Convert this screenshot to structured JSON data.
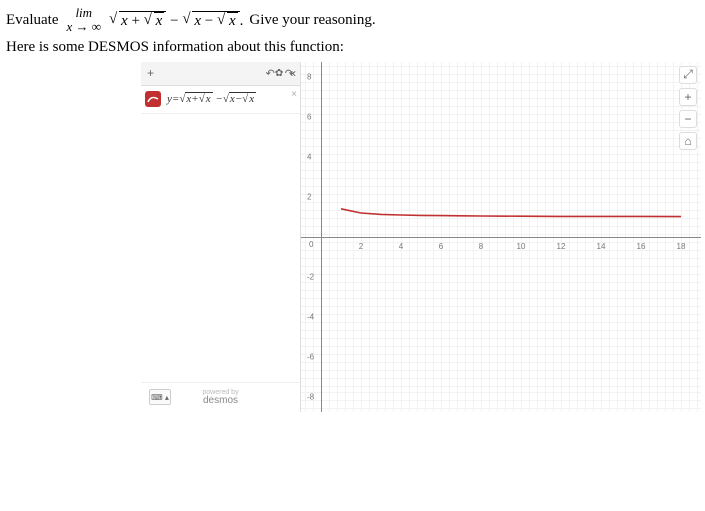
{
  "problem": {
    "prefix": "Evaluate",
    "limit_top": "lim",
    "limit_bottom": "x → ∞",
    "expr_outer1_inner_var": "x",
    "expr_plus": " + ",
    "expr_minus_big": " − ",
    "expr_outer2_inner_var": "x",
    "expr_minus_small": " − ",
    "period": ".",
    "suffix": "  Give your reasoning."
  },
  "desmos_info": "Here is some DESMOS information about this function:",
  "sidebar": {
    "plus": "+",
    "undo": "↶",
    "redo": "↷",
    "gear": "✿",
    "collapse": "«",
    "expr_label_y": "y",
    "expr_label_eq": "=",
    "expr_label_a": "x+",
    "expr_label_b": "x",
    "expr_label_c": "x−",
    "expr_label_d": "x",
    "expr_minus": " −",
    "close": "×",
    "keyboard": "⌨ ▴",
    "powered_by": "powered by",
    "brand": "desmos"
  },
  "controls": {
    "zoom_tool": "⤢",
    "zoom_in": "+",
    "zoom_out": "−",
    "home": "⌂"
  },
  "axes": {
    "x_ticks": [
      {
        "v": "2",
        "px": 60
      },
      {
        "v": "4",
        "px": 100
      },
      {
        "v": "6",
        "px": 140
      },
      {
        "v": "8",
        "px": 180
      },
      {
        "v": "10",
        "px": 220
      },
      {
        "v": "12",
        "px": 260
      },
      {
        "v": "14",
        "px": 300
      },
      {
        "v": "16",
        "px": 340
      },
      {
        "v": "18",
        "px": 380
      }
    ],
    "y_ticks": [
      {
        "v": "8",
        "px": 15
      },
      {
        "v": "6",
        "px": 55
      },
      {
        "v": "4",
        "px": 95
      },
      {
        "v": "2",
        "px": 135
      },
      {
        "v": "-2",
        "px": 215
      },
      {
        "v": "-4",
        "px": 255
      },
      {
        "v": "-6",
        "px": 295
      },
      {
        "v": "-8",
        "px": 335
      }
    ],
    "origin": "0"
  },
  "chart_data": {
    "type": "line",
    "title": "",
    "xlabel": "",
    "ylabel": "",
    "xlim": [
      0,
      19
    ],
    "ylim": [
      -9,
      9
    ],
    "series": [
      {
        "name": "y = √(x+√x) − √(x−√x)",
        "color": "#c13030",
        "x": [
          1,
          2,
          3,
          4,
          5,
          6,
          7,
          8,
          10,
          12,
          14,
          16,
          18
        ],
        "values": [
          1.41,
          1.2,
          1.13,
          1.1,
          1.08,
          1.07,
          1.06,
          1.05,
          1.04,
          1.03,
          1.03,
          1.03,
          1.02
        ]
      }
    ],
    "note": "curve approaches y=1 as x→∞"
  }
}
